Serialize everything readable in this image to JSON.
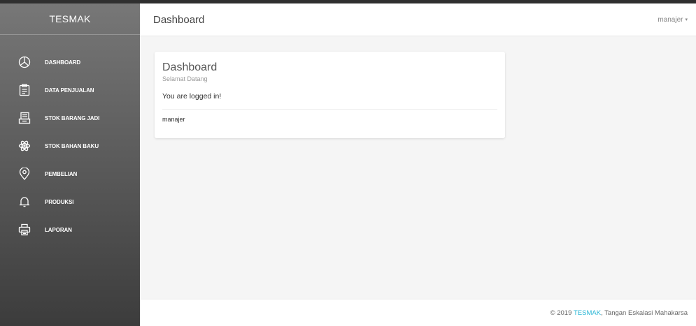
{
  "sidebar": {
    "brand": "TESMAK",
    "items": [
      {
        "label": "DASHBOARD",
        "icon": "pie-chart-icon"
      },
      {
        "label": "DATA PENJUALAN",
        "icon": "clipboard-icon"
      },
      {
        "label": "STOK BARANG JADI",
        "icon": "archive-icon"
      },
      {
        "label": "STOK BAHAN BAKU",
        "icon": "atom-icon"
      },
      {
        "label": "PEMBELIAN",
        "icon": "map-pin-icon"
      },
      {
        "label": "PRODUKSI",
        "icon": "bell-icon"
      },
      {
        "label": "LAPORAN",
        "icon": "printer-icon"
      }
    ]
  },
  "header": {
    "title": "Dashboard",
    "user": "manajer",
    "caret": "▾"
  },
  "card": {
    "title": "Dashboard",
    "subtitle": "Selamat Datang",
    "message": "You are logged in!",
    "footer": "manajer"
  },
  "footer": {
    "prefix": "© 2019 ",
    "link": "TESMAK",
    "suffix": ", Tangan Eskalasi Mahakarsa"
  },
  "colors": {
    "link": "#29b6d5",
    "sidebar_top": "#777777",
    "sidebar_bottom": "#3c3c3c",
    "content_bg": "#f5f5f5"
  }
}
